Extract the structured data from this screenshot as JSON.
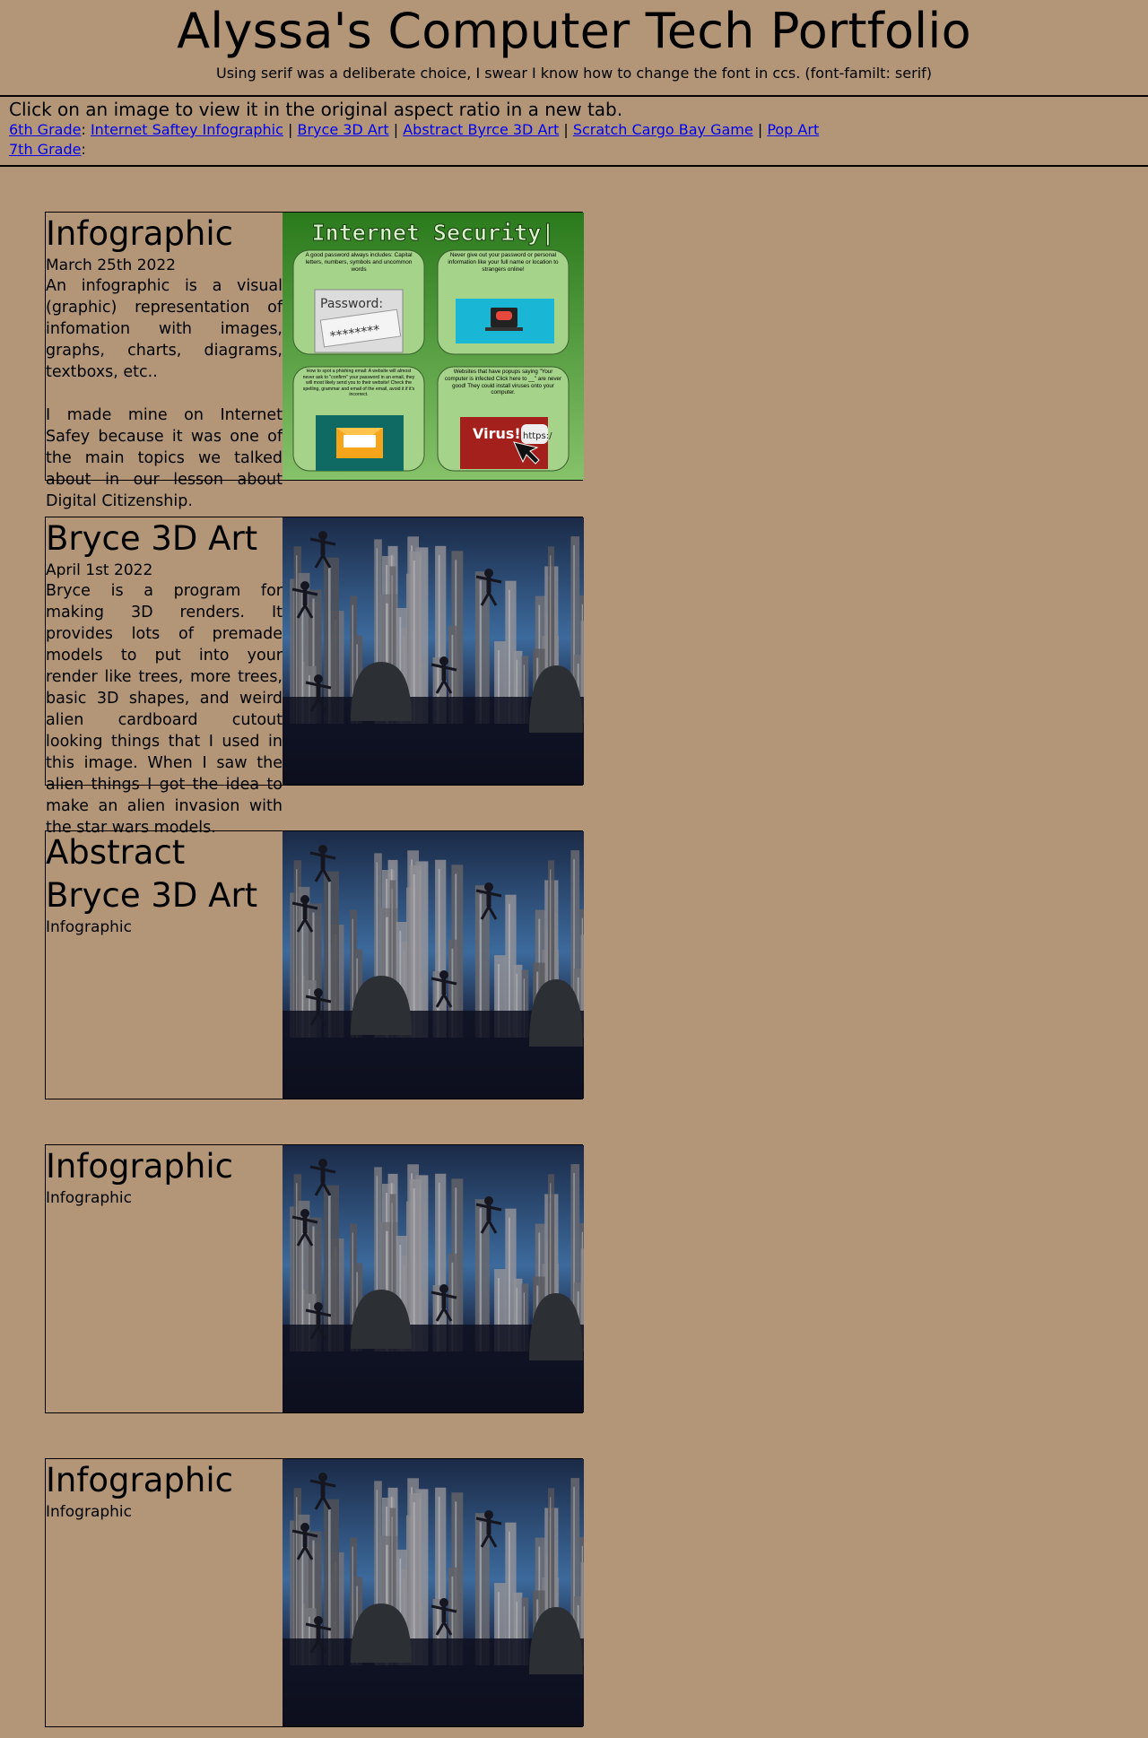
{
  "header": {
    "title": "Alyssa's Computer Tech Portfolio",
    "subtitle": "Using serif was a deliberate choice, I swear I know how to change the font in ccs. (font-familt: serif)"
  },
  "nav": {
    "hint": "Click on an image to view it in the original aspect ratio in a new tab.",
    "rows": [
      {
        "grade": "6th Grade",
        "links": [
          "Internet Saftey Infographic",
          "Bryce 3D Art",
          "Abstract Byrce 3D Art",
          "Scratch Cargo Bay Game",
          "Pop Art"
        ]
      },
      {
        "grade": "7th Grade",
        "links": []
      }
    ],
    "colon": ":",
    "separator": "|"
  },
  "cards": [
    {
      "title": "Infographic",
      "date": "March 25th 2022",
      "body": "An infographic is a visual (graphic) representation of infomation with images, graphs, charts, diagrams, textboxs, etc..\n\nI made mine on Internet Safey because it was one of the main topics we talked about in our lesson about Digital Citizenship.",
      "image": "infographic"
    },
    {
      "title": "Bryce 3D Art",
      "date": "April 1st 2022",
      "body": "Bryce is a program for making 3D renders. It provides lots of premade models to put into your render like trees, more trees, basic 3D shapes, and weird alien cardboard cutout looking things that I used in this image. When I saw the alien things I got the idea to make an alien invasion with the star wars models.",
      "image": "bryce"
    },
    {
      "title": "Abstract Bryce 3D Art",
      "date": "Infographic",
      "body": "",
      "image": "bryce"
    },
    {
      "title": "Infographic",
      "date": "Infographic",
      "body": "",
      "image": "bryce"
    },
    {
      "title": "Infographic",
      "date": "Infographic",
      "body": "",
      "image": "bryce"
    }
  ],
  "infographic": {
    "title": "Internet Security|",
    "panels": [
      "A good password always includes: Capital letters, numbers, symbols and uncommon words",
      "Never give out your password or personal information like your full name or location to strangers online!",
      "How to spot a phishing email: A website will almost never ask to \"confirm\" your password in an email, they will most likely send you to their website! Check the spelling, grammar and email of the email, avoid it if it's incorrect.",
      "Websites that have popups saying \"Your computer is infected Click here to __\" are never good! They could install viruses onto your computer."
    ],
    "password_label": "Password:",
    "password_mask": "********",
    "virus_label": "Virus!",
    "url_label": "https:/",
    "colors": {
      "background": "#2f7d22",
      "panel": "#a5d38a"
    }
  },
  "bryce_colors": {
    "sky": "#2f4f7a",
    "ground": "#0e1020",
    "tower": "#6e6e72"
  }
}
